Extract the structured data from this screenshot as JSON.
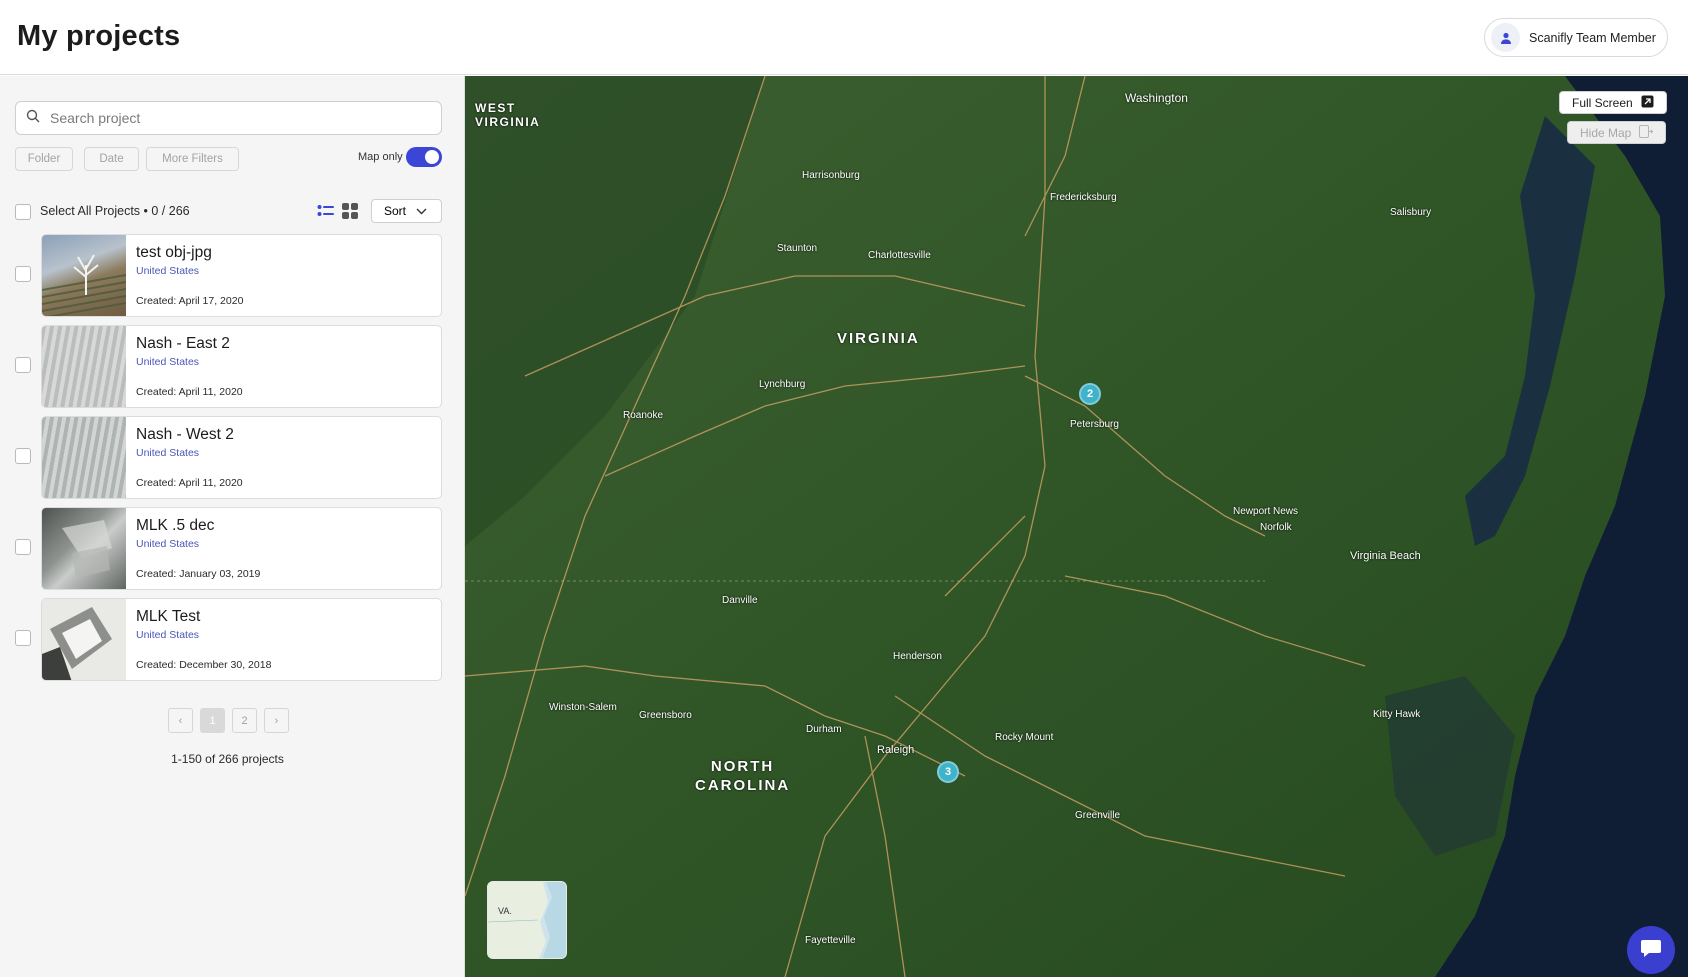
{
  "header": {
    "title": "My projects",
    "user_name": "Scanifly Team Member"
  },
  "search": {
    "placeholder": "Search project"
  },
  "filters": [
    {
      "label": "Folder"
    },
    {
      "label": "Date"
    },
    {
      "label": "More Filters"
    }
  ],
  "map_only": {
    "label": "Map only",
    "enabled": true
  },
  "selection": {
    "label": "Select All Projects",
    "count": "• 0 / 266"
  },
  "sort": {
    "label": "Sort"
  },
  "projects": [
    {
      "name": "test obj-jpg",
      "country": "United States",
      "created": "Created: April 17, 2020"
    },
    {
      "name": "Nash - East 2",
      "country": "United States",
      "created": "Created: April 11, 2020"
    },
    {
      "name": "Nash - West 2",
      "country": "United States",
      "created": "Created: April 11, 2020"
    },
    {
      "name": "MLK .5 dec",
      "country": "United States",
      "created": "Created: January 03, 2019"
    },
    {
      "name": "MLK Test",
      "country": "United States",
      "created": "Created: December 30, 2018"
    }
  ],
  "pagination": {
    "prev": "‹",
    "pages": [
      "1",
      "2"
    ],
    "current": "1",
    "next": "›",
    "range": "1-150 of 266 projects"
  },
  "map": {
    "fullscreen_label": "Full Screen",
    "hidemap_label": "Hide Map",
    "clusters": [
      "2",
      "3"
    ],
    "minimap_label": "VA.",
    "labels": {
      "west_virginia": "WEST\nVIRGINIA",
      "virginia": "VIRGINIA",
      "north_carolina": "NORTH\nCAROLINA",
      "washington": "Washington",
      "virginia_beach": "Virginia Beach",
      "charlottesville": "Charlottesville",
      "lynchburg": "Lynchburg",
      "roanoke": "Roanoke",
      "petersburg": "Petersburg",
      "fredericksburg": "Fredericksburg",
      "durham": "Durham",
      "raleigh": "Raleigh",
      "greensboro": "Greensboro",
      "winston_salem": "Winston-Salem",
      "norfolk": "Norfolk",
      "newport_news": "Newport News",
      "kitty_hawk": "Kitty Hawk",
      "fayetteville": "Fayetteville",
      "danville": "Danville",
      "staunton": "Staunton",
      "harrisonburg": "Harrisonburg",
      "salisbury": "Salisbury",
      "henderson": "Henderson",
      "rocky_mount": "Rocky Mount",
      "greenville": "Greenville"
    }
  },
  "colors": {
    "accent": "#3b46d6",
    "cluster": "#3eb3c9",
    "map_land": "#2f5a27",
    "map_water": "#0d1b33"
  }
}
